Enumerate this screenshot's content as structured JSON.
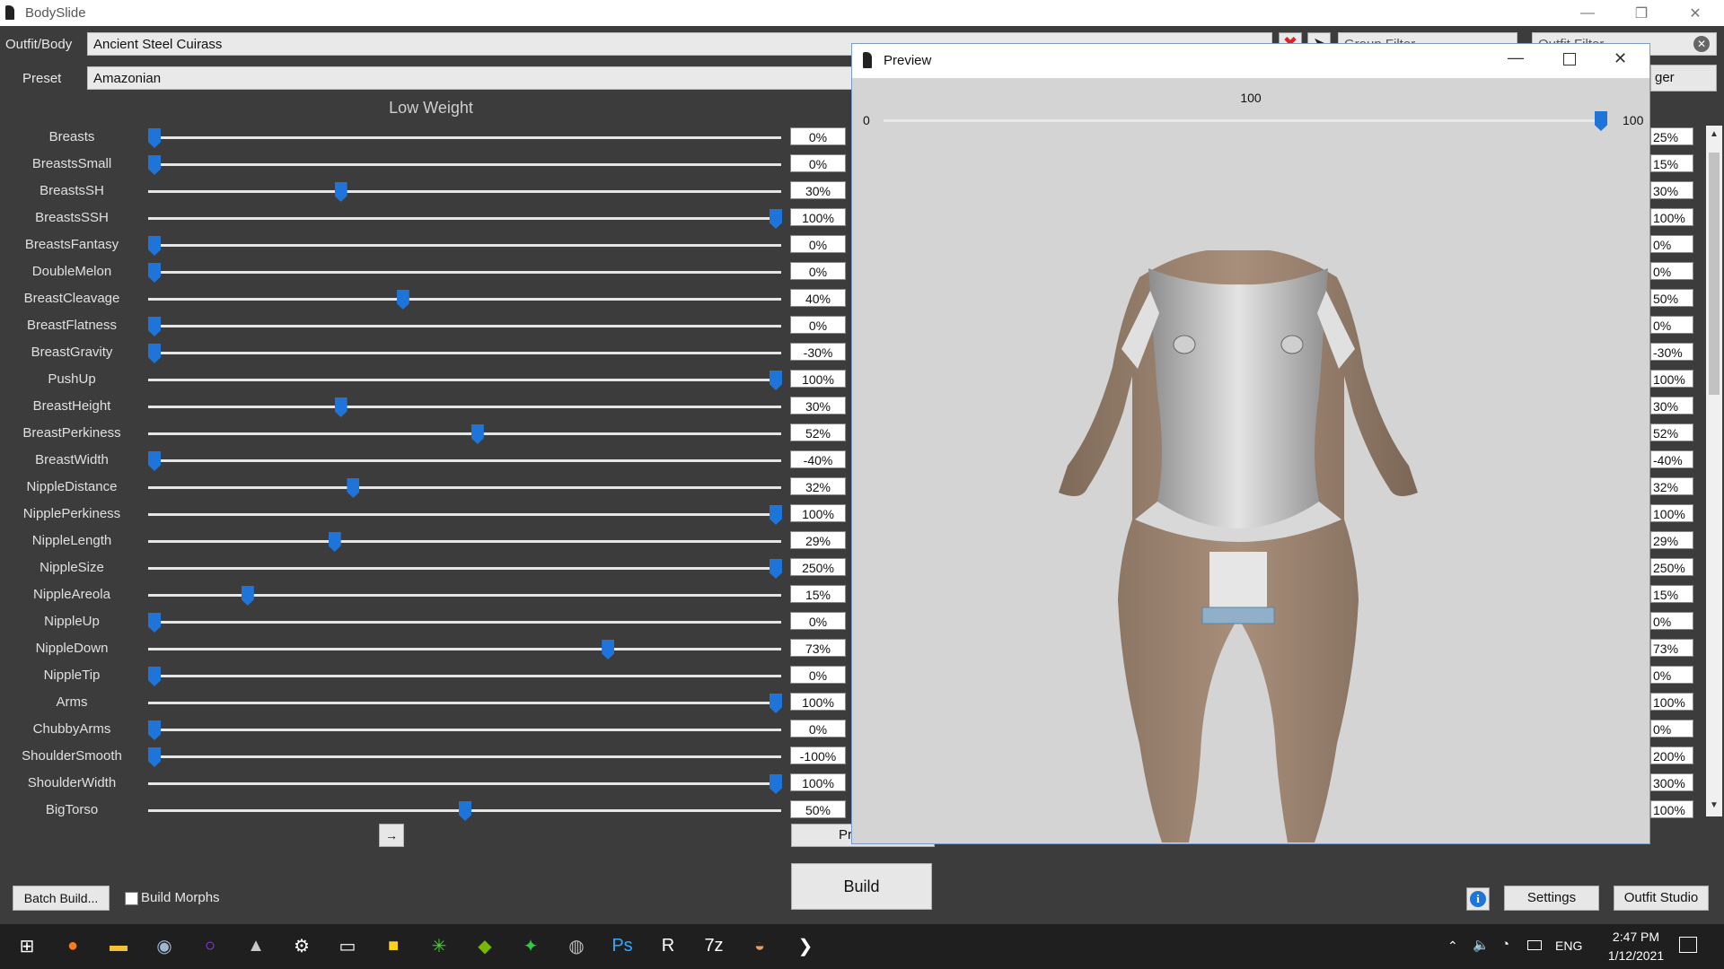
{
  "app": {
    "title": "BodySlide"
  },
  "outfit": {
    "label": "Outfit/Body",
    "value": "Ancient Steel Cuirass"
  },
  "preset": {
    "label": "Preset",
    "value": "Amazonian"
  },
  "filters": {
    "group_placeholder": "Group Filter",
    "outfit_placeholder": "Outfit Filter",
    "ger_fragment": "ger"
  },
  "low_weight": {
    "title": "Low Weight",
    "sliders": [
      {
        "name": "Breasts",
        "value": "0%",
        "pos": 0.0
      },
      {
        "name": "BreastsSmall",
        "value": "0%",
        "pos": 0.0
      },
      {
        "name": "BreastsSH",
        "value": "30%",
        "pos": 0.3
      },
      {
        "name": "BreastsSSH",
        "value": "100%",
        "pos": 1.0
      },
      {
        "name": "BreastsFantasy",
        "value": "0%",
        "pos": 0.0
      },
      {
        "name": "DoubleMelon",
        "value": "0%",
        "pos": 0.0
      },
      {
        "name": "BreastCleavage",
        "value": "40%",
        "pos": 0.4
      },
      {
        "name": "BreastFlatness",
        "value": "0%",
        "pos": 0.0
      },
      {
        "name": "BreastGravity",
        "value": "-30%",
        "pos": 0.0
      },
      {
        "name": "PushUp",
        "value": "100%",
        "pos": 1.0
      },
      {
        "name": "BreastHeight",
        "value": "30%",
        "pos": 0.3
      },
      {
        "name": "BreastPerkiness",
        "value": "52%",
        "pos": 0.52
      },
      {
        "name": "BreastWidth",
        "value": "-40%",
        "pos": 0.0
      },
      {
        "name": "NippleDistance",
        "value": "32%",
        "pos": 0.32
      },
      {
        "name": "NipplePerkiness",
        "value": "100%",
        "pos": 1.0
      },
      {
        "name": "NippleLength",
        "value": "29%",
        "pos": 0.29
      },
      {
        "name": "NippleSize",
        "value": "250%",
        "pos": 1.0
      },
      {
        "name": "NippleAreola",
        "value": "15%",
        "pos": 0.15
      },
      {
        "name": "NippleUp",
        "value": "0%",
        "pos": 0.0
      },
      {
        "name": "NippleDown",
        "value": "73%",
        "pos": 0.73
      },
      {
        "name": "NippleTip",
        "value": "0%",
        "pos": 0.0
      },
      {
        "name": "Arms",
        "value": "100%",
        "pos": 1.0
      },
      {
        "name": "ChubbyArms",
        "value": "0%",
        "pos": 0.0
      },
      {
        "name": "ShoulderSmooth",
        "value": "-100%",
        "pos": 0.0
      },
      {
        "name": "ShoulderWidth",
        "value": "100%",
        "pos": 1.0
      },
      {
        "name": "BigTorso",
        "value": "50%",
        "pos": 0.5
      }
    ]
  },
  "high_weight_values": [
    "25%",
    "15%",
    "30%",
    "100%",
    "0%",
    "0%",
    "50%",
    "0%",
    "-30%",
    "100%",
    "30%",
    "52%",
    "-40%",
    "32%",
    "100%",
    "29%",
    "250%",
    "15%",
    "0%",
    "73%",
    "0%",
    "100%",
    "0%",
    "200%",
    "300%",
    "100%"
  ],
  "preview": {
    "title": "Preview",
    "weight_value": "100",
    "weight_min": "0",
    "weight_max": "100",
    "weight_pos": 1.0
  },
  "buttons": {
    "arrow": "→",
    "preview_fragment": "Pr",
    "build": "Build",
    "batch_build": "Batch Build...",
    "build_morphs": "Build Morphs",
    "settings": "Settings",
    "outfit_studio": "Outfit Studio",
    "info": "i"
  },
  "taskbar": {
    "lang": "ENG",
    "time": "2:47 PM",
    "date": "1/12/2021",
    "icons": [
      "windows-start",
      "firefox",
      "file-explorer",
      "steam",
      "cortana-ring",
      "razer-cortex",
      "settings-gear",
      "folder-utility",
      "sticky-notes",
      "razer-synapse",
      "nvidia",
      "green-app",
      "disc-app",
      "photoshop",
      "r-app",
      "7zip",
      "bowl-app",
      "bodyslide-taskbar"
    ],
    "tray": [
      "chevron-up",
      "volume",
      "network",
      "battery"
    ]
  },
  "colors": {
    "accent": "#1e74d8",
    "background": "#3c3c3c",
    "preview_bg": "#d4d4d4"
  }
}
